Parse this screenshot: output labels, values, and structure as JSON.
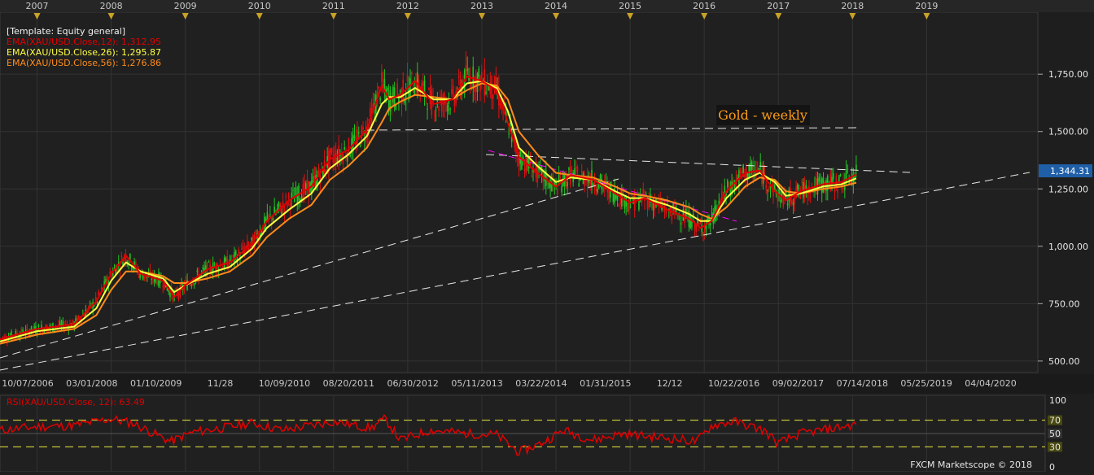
{
  "window": {
    "template_label": "[Template: Equity general]",
    "footer": "FXCM Marketscope © 2018"
  },
  "top_axis": {
    "years": [
      "2007",
      "2008",
      "2009",
      "2010",
      "2011",
      "2012",
      "2013",
      "2014",
      "2015",
      "2016",
      "2017",
      "2018",
      "2019"
    ]
  },
  "x_axis": {
    "labels": [
      "10/07/2006",
      "03/01/2008",
      "01/10/2009",
      "11/28",
      "10/09/2010",
      "08/20/2011",
      "06/30/2012",
      "05/11/2013",
      "03/22/2014",
      "01/31/2015",
      "12/12",
      "10/22/2016",
      "09/02/2017",
      "07/14/2018",
      "05/25/2019",
      "04/04/2020"
    ]
  },
  "colors": {
    "background": "#1e1e1e",
    "up_candle": "#22c322",
    "down_candle": "#e01010",
    "ema12": "#e00000",
    "ema26": "#ffff40",
    "ema56": "#ff8c1a",
    "rsi": "#e00000",
    "rsi_levels": "#e6e640",
    "trendline": "#e8e8e8",
    "channel_line": "#ff00ff",
    "price_box": "#1f5fa8"
  },
  "chart_data": [
    {
      "type": "line",
      "title": "Gold - weekly",
      "subtitle": "",
      "xlabel": "",
      "ylabel": "",
      "x_range": [
        2006.5,
        2020.5
      ],
      "ylim": [
        450,
        2020
      ],
      "y_ticks": [
        "1,750.00",
        "1,500.00",
        "1,250.00",
        "1,000.00",
        "750.00",
        "500.00"
      ],
      "y_tick_values": [
        1750,
        1500,
        1250,
        1000,
        750,
        500
      ],
      "last_price_label": "1,344.31",
      "last_price": 1344.31,
      "grid": true,
      "legend_placement": "top-left",
      "x": [
        2006.5,
        2007.0,
        2007.5,
        2007.8,
        2008.0,
        2008.2,
        2008.4,
        2008.7,
        2008.85,
        2009.0,
        2009.3,
        2009.6,
        2009.9,
        2010.1,
        2010.4,
        2010.7,
        2010.95,
        2011.2,
        2011.45,
        2011.65,
        2011.75,
        2011.9,
        2012.1,
        2012.35,
        2012.6,
        2012.8,
        2013.0,
        2013.2,
        2013.35,
        2013.5,
        2013.75,
        2014.0,
        2014.2,
        2014.5,
        2014.8,
        2015.0,
        2015.2,
        2015.5,
        2015.8,
        2015.95,
        2016.1,
        2016.3,
        2016.55,
        2016.75,
        2016.95,
        2017.1,
        2017.3,
        2017.6,
        2017.85,
        2018.05
      ],
      "series": [
        {
          "name": "EMA(XAU/USD.Close,12): 1,312.95",
          "color": "#e00000",
          "values": [
            595,
            640,
            660,
            760,
            880,
            960,
            880,
            850,
            780,
            830,
            900,
            930,
            1010,
            1110,
            1200,
            1260,
            1380,
            1420,
            1510,
            1700,
            1640,
            1660,
            1720,
            1620,
            1640,
            1740,
            1720,
            1680,
            1540,
            1390,
            1320,
            1260,
            1310,
            1290,
            1230,
            1190,
            1210,
            1160,
            1120,
            1080,
            1110,
            1240,
            1320,
            1330,
            1240,
            1200,
            1240,
            1270,
            1280,
            1312.95
          ]
        },
        {
          "name": "EMA(XAU/USD.Close,26): 1,295.87",
          "color": "#ffff40",
          "values": [
            585,
            630,
            650,
            730,
            850,
            930,
            890,
            860,
            800,
            830,
            880,
            910,
            990,
            1080,
            1160,
            1230,
            1340,
            1400,
            1480,
            1620,
            1650,
            1650,
            1690,
            1640,
            1640,
            1710,
            1720,
            1690,
            1590,
            1430,
            1350,
            1280,
            1300,
            1290,
            1240,
            1210,
            1210,
            1180,
            1140,
            1110,
            1110,
            1210,
            1290,
            1320,
            1280,
            1220,
            1230,
            1260,
            1270,
            1295.87
          ]
        },
        {
          "name": "EMA(XAU/USD.Close,56): 1,276.86",
          "color": "#ff8c1a",
          "values": [
            575,
            615,
            640,
            700,
            810,
            890,
            890,
            870,
            840,
            840,
            860,
            890,
            960,
            1040,
            1120,
            1180,
            1290,
            1350,
            1430,
            1540,
            1600,
            1630,
            1660,
            1650,
            1640,
            1680,
            1710,
            1700,
            1640,
            1500,
            1400,
            1320,
            1310,
            1300,
            1260,
            1230,
            1220,
            1200,
            1170,
            1140,
            1120,
            1170,
            1260,
            1300,
            1290,
            1240,
            1230,
            1250,
            1260,
            1276.86
          ]
        }
      ]
    },
    {
      "type": "line",
      "title": "",
      "xlabel": "",
      "ylabel": "",
      "ylim": [
        0,
        100
      ],
      "y_ticks": [
        "100",
        "70",
        "50",
        "30",
        "0"
      ],
      "y_tick_values": [
        100,
        70,
        50,
        30,
        0
      ],
      "levels": [
        70,
        30
      ],
      "series": [
        {
          "name": "RSI(XAU/USD.Close, 12): 63.49",
          "color": "#e00000",
          "x": [
            2006.5,
            2007.0,
            2007.5,
            2008.0,
            2008.3,
            2008.8,
            2009.1,
            2009.6,
            2009.9,
            2010.3,
            2010.7,
            2011.0,
            2011.5,
            2011.7,
            2011.9,
            2012.3,
            2012.8,
            2013.2,
            2013.5,
            2013.8,
            2014.1,
            2014.5,
            2014.9,
            2015.3,
            2015.6,
            2015.9,
            2016.1,
            2016.4,
            2016.8,
            2017.0,
            2017.3,
            2017.6,
            2017.85,
            2018.05
          ],
          "values": [
            55,
            60,
            62,
            72,
            65,
            38,
            52,
            60,
            66,
            55,
            62,
            68,
            58,
            72,
            40,
            55,
            50,
            48,
            22,
            35,
            55,
            40,
            50,
            45,
            42,
            38,
            62,
            68,
            55,
            35,
            50,
            55,
            60,
            63.49
          ]
        }
      ]
    }
  ],
  "overlays": {
    "title_box_text": "Gold - weekly"
  }
}
